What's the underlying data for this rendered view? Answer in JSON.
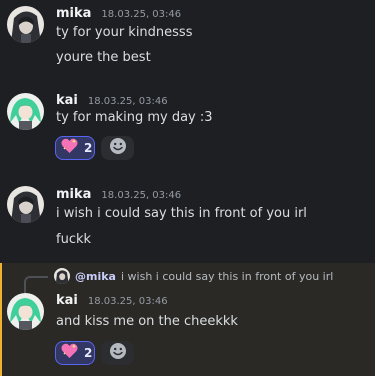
{
  "messages": [
    {
      "author": "mika",
      "timestamp": "18.03.25, 03:46",
      "avatar_icon": "mika-avatar-icon",
      "lines": [
        "ty for your kindnesss",
        "youre the best"
      ]
    },
    {
      "author": "kai",
      "timestamp": "18.03.25, 03:46",
      "avatar_icon": "kai-avatar-icon",
      "lines": [
        "ty for making my day :3"
      ],
      "reaction": {
        "emoji_icon": "sparkling-heart-icon",
        "count": "2"
      },
      "add_reaction_icon": "add-reaction-smiley-icon"
    },
    {
      "author": "mika",
      "timestamp": "18.03.25, 03:46",
      "avatar_icon": "mika-avatar-icon",
      "lines": [
        "i wish i could say this in front of you irl",
        "fuckk"
      ]
    },
    {
      "author": "kai",
      "timestamp": "18.03.25, 03:46",
      "avatar_icon": "kai-avatar-icon",
      "highlighted": true,
      "reply_to": {
        "author": "@mika",
        "text": "i wish i could say this in front of you irl"
      },
      "lines": [
        "and kiss me on the cheekkk"
      ],
      "reaction": {
        "emoji_icon": "sparkling-heart-icon",
        "count": "2"
      },
      "add_reaction_icon": "add-reaction-smiley-icon"
    }
  ],
  "colors": {
    "background": "#1e1f22",
    "highlight_bg": "#2a2925",
    "highlight_bar": "#f0b232",
    "reaction_bg": "#323764",
    "reaction_border": "#5865f2",
    "kai_hair": "#3fcf9b",
    "mika_hair": "#3a3d44"
  }
}
